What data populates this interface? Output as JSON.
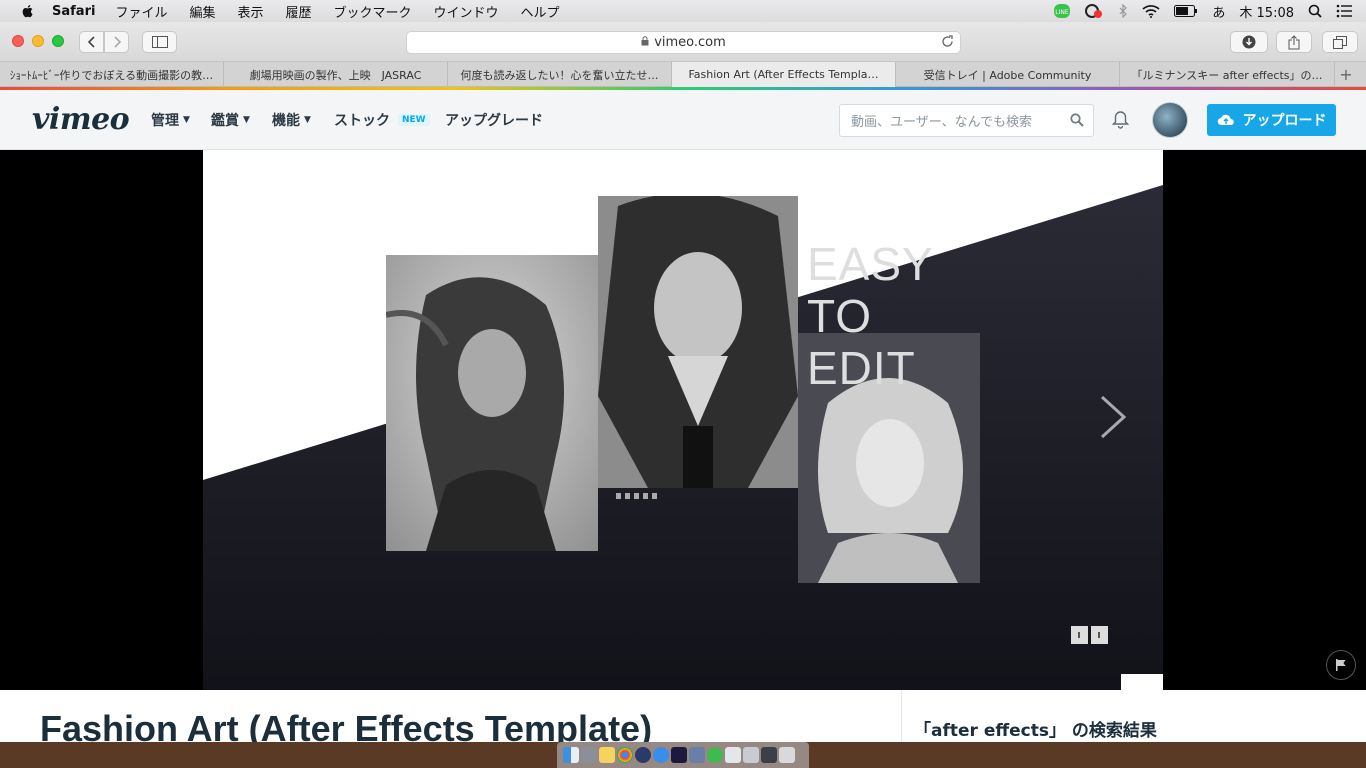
{
  "menubar": {
    "app_name": "Safari",
    "items": [
      "ファイル",
      "編集",
      "表示",
      "履歴",
      "ブックマーク",
      "ウインドウ",
      "ヘルプ"
    ],
    "input_mode": "あ",
    "clock": "木 15:08"
  },
  "browser": {
    "url": "vimeo.com",
    "tabs": [
      {
        "label": "ｼｮｰﾄﾑｰﾋﾞｰ作りでおぼえる動画撮影の教…",
        "active": false
      },
      {
        "label": "劇場用映画の製作、上映　JASRAC",
        "active": false
      },
      {
        "label": "何度も読み返したい！心を奮い立たせ…",
        "active": false
      },
      {
        "label": "Fashion Art (After Effects Templa…",
        "active": true
      },
      {
        "label": "受信トレイ | Adobe Community",
        "active": false
      },
      {
        "label": "「ルミナンスキー after effects」の…",
        "active": false
      }
    ],
    "new_tab": "+"
  },
  "vimeo": {
    "logo": "vimeo",
    "nav": {
      "manage": "管理",
      "watch": "鑑賞",
      "features": "機能",
      "stock": "ストック",
      "stock_badge": "NEW",
      "upgrade": "アップグレード"
    },
    "search_placeholder": "動画、ユーザー、なんでも検索",
    "upload_label": "アップロード"
  },
  "video": {
    "overlay_line1": "EASY",
    "overlay_line2": "TO",
    "overlay_line3": "EDIT"
  },
  "page": {
    "video_title": "Fashion Art (After Effects Template)",
    "search_results_heading": "「after effects」 の検索結果"
  },
  "colors": {
    "accent": "#17a6e8",
    "vimeo_text": "#1a2e3b"
  }
}
